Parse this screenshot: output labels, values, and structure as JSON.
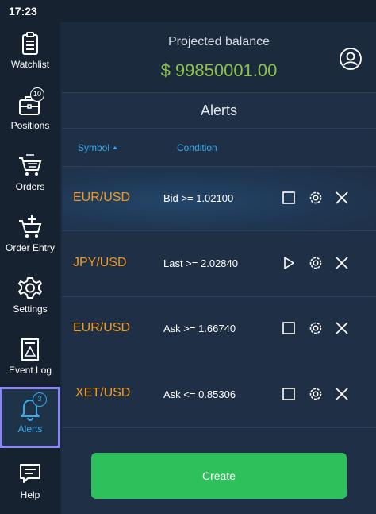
{
  "status": {
    "time": "17:23"
  },
  "sidebar": {
    "items": [
      {
        "label": "Watchlist",
        "icon": "clipboard-icon"
      },
      {
        "label": "Positions",
        "icon": "briefcase-icon",
        "badge": "10"
      },
      {
        "label": "Orders",
        "icon": "cart-list-icon"
      },
      {
        "label": "Order Entry",
        "icon": "cart-add-icon"
      },
      {
        "label": "Settings",
        "icon": "gear-icon"
      },
      {
        "label": "Event Log",
        "icon": "log-icon"
      },
      {
        "label": "Alerts",
        "icon": "bell-icon",
        "badge": "3",
        "active": true
      },
      {
        "label": "Help",
        "icon": "chat-icon"
      }
    ]
  },
  "header": {
    "balance_title": "Projected balance",
    "balance_value": "$ 99850001.00",
    "balance_color": "#8bc34a",
    "account_icon": "account-circle-icon"
  },
  "alerts": {
    "title": "Alerts",
    "columns": {
      "symbol": "Symbol",
      "condition": "Condition"
    },
    "sort": "symbol-ascending",
    "rows": [
      {
        "symbol": "EUR/USD",
        "condition": "Bid >= 1.02100",
        "state_icon": "square-icon",
        "highlighted": true
      },
      {
        "symbol": "JPY/USD",
        "condition": "Last >= 2.02840",
        "state_icon": "play-icon",
        "highlighted": false
      },
      {
        "symbol": "EUR/USD",
        "condition": "Ask >= 1.66740",
        "state_icon": "square-icon",
        "highlighted": false
      },
      {
        "symbol": "XET/USD",
        "condition": "Ask <= 0.85306",
        "state_icon": "square-icon",
        "highlighted": false
      }
    ]
  },
  "actions": {
    "create_label": "Create"
  },
  "colors": {
    "accent": "#39a9ea",
    "symbol": "#f39a1d",
    "create": "#2ec05a",
    "active_outline": "#8b87f0"
  }
}
